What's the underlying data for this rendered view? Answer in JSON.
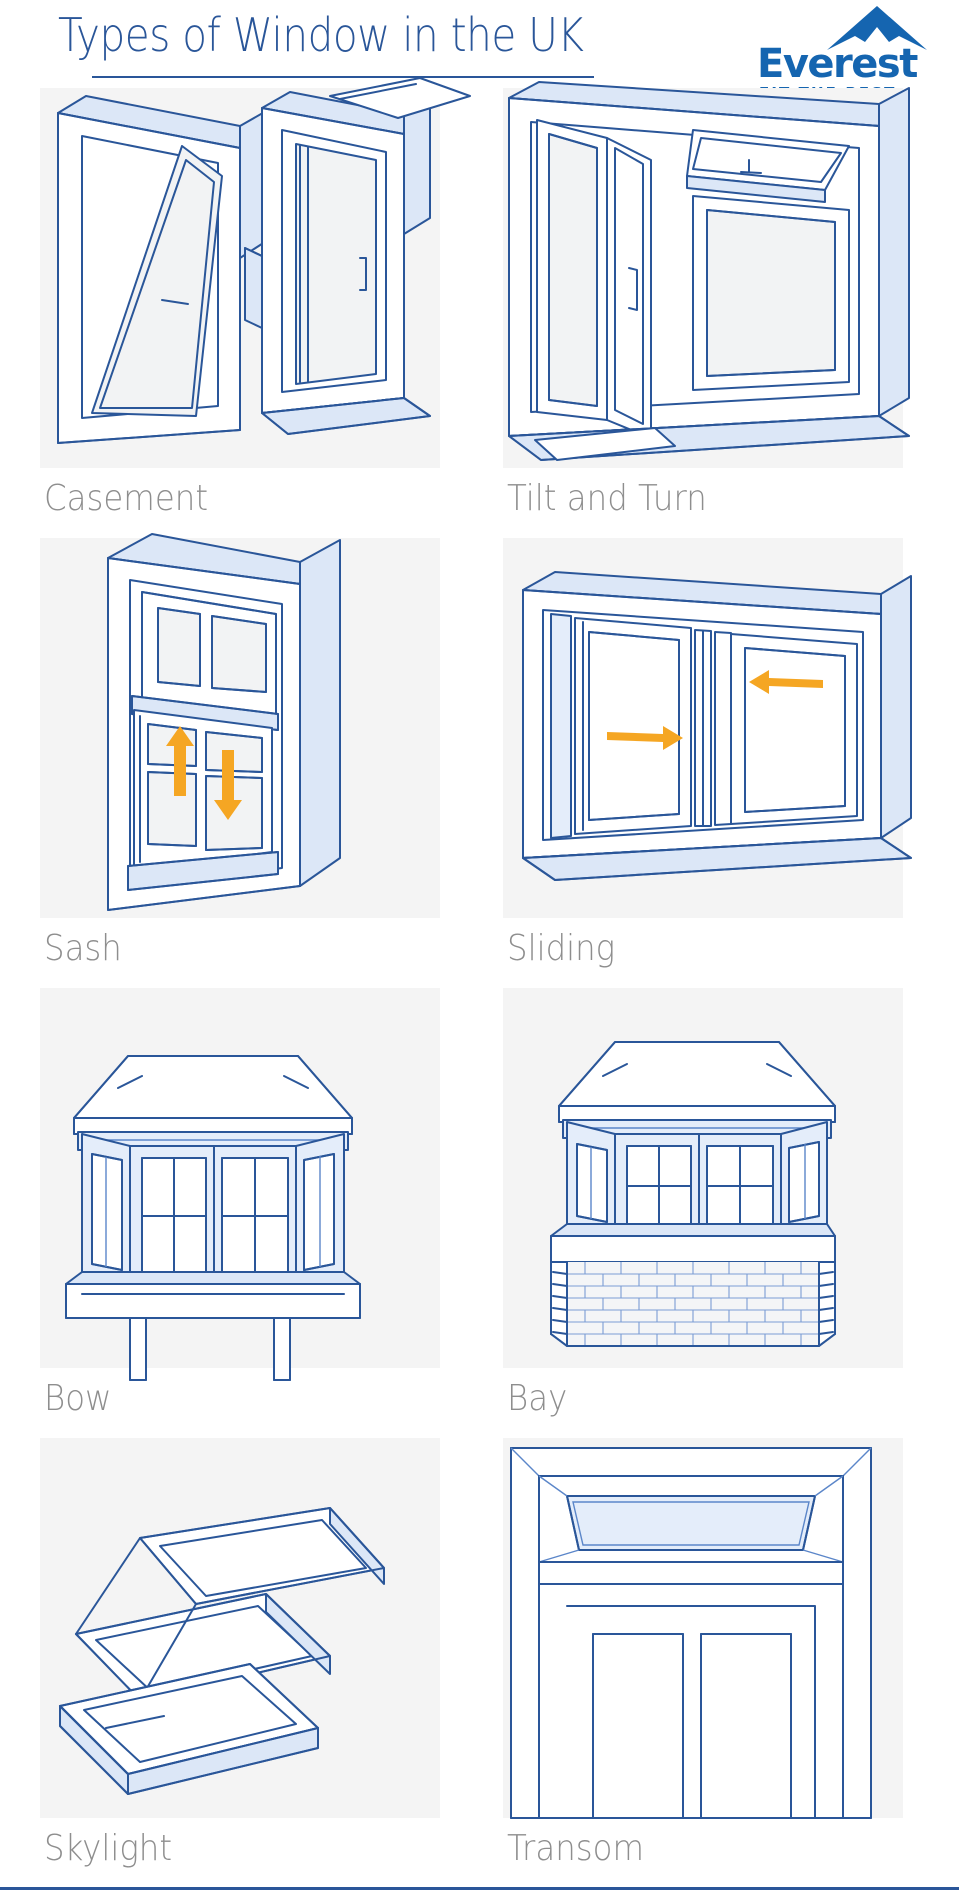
{
  "header": {
    "title": "Types of Window in the UK",
    "logo": {
      "wordmark": "Everest",
      "tagline": "FIT THE BEST",
      "icon": "mountain-peak-icon"
    }
  },
  "colors": {
    "title_blue": "#2a5699",
    "logo_blue": "#1565b0",
    "line_blue": "#2a5699",
    "accent_light_blue": "#dce7f7",
    "arrow_orange": "#f5a623",
    "panel_bg": "#f4f4f4",
    "label_gray": "#8e8e8e",
    "page_bg": "#ffffff"
  },
  "windows": [
    {
      "label": "Casement",
      "illustration": "casement-window-illustration",
      "arrows": []
    },
    {
      "label": "Tilt and Turn",
      "illustration": "tilt-and-turn-window-illustration",
      "arrows": []
    },
    {
      "label": "Sash",
      "illustration": "sash-window-illustration",
      "arrows": [
        "up-arrow",
        "down-arrow"
      ]
    },
    {
      "label": "Sliding",
      "illustration": "sliding-window-illustration",
      "arrows": [
        "right-arrow",
        "left-arrow"
      ]
    },
    {
      "label": "Bow",
      "illustration": "bow-window-illustration",
      "arrows": []
    },
    {
      "label": "Bay",
      "illustration": "bay-window-illustration",
      "arrows": []
    },
    {
      "label": "Skylight",
      "illustration": "skylight-window-illustration",
      "arrows": []
    },
    {
      "label": "Transom",
      "illustration": "transom-window-illustration",
      "arrows": []
    }
  ]
}
